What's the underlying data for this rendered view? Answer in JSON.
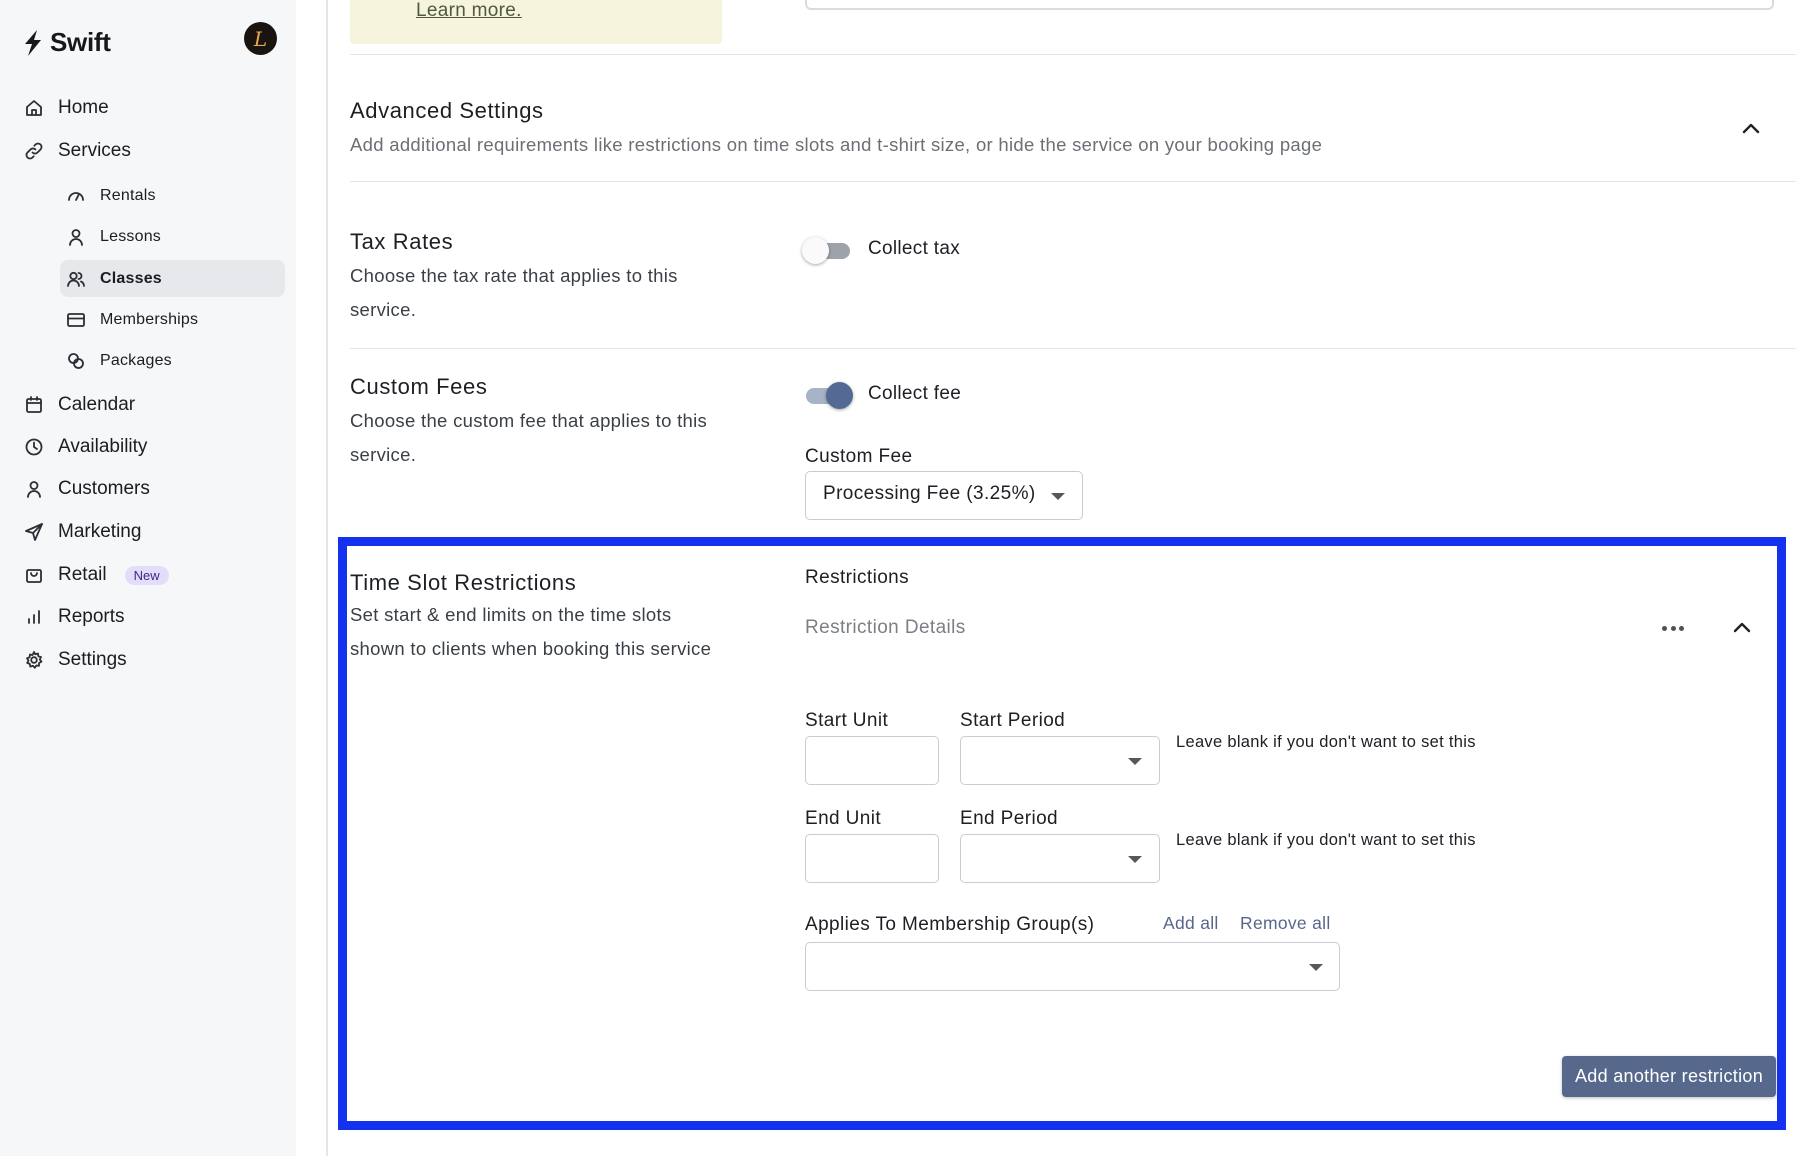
{
  "app": {
    "name": "Swift",
    "avatar_initial": "L"
  },
  "sidebar": {
    "items": [
      {
        "label": "Home",
        "icon": "home-icon"
      },
      {
        "label": "Services",
        "icon": "link-icon"
      },
      {
        "label": "Calendar",
        "icon": "calendar-icon"
      },
      {
        "label": "Availability",
        "icon": "clock-icon"
      },
      {
        "label": "Customers",
        "icon": "user-icon"
      },
      {
        "label": "Marketing",
        "icon": "send-icon"
      },
      {
        "label": "Retail",
        "icon": "bag-icon",
        "badge": "New"
      },
      {
        "label": "Reports",
        "icon": "bar-chart-icon"
      },
      {
        "label": "Settings",
        "icon": "gear-icon"
      }
    ],
    "services_sub": [
      {
        "label": "Rentals",
        "icon": "gauge-icon"
      },
      {
        "label": "Lessons",
        "icon": "person-icon"
      },
      {
        "label": "Classes",
        "icon": "people-icon",
        "active": true
      },
      {
        "label": "Memberships",
        "icon": "card-icon"
      },
      {
        "label": "Packages",
        "icon": "coins-icon"
      }
    ]
  },
  "notice": {
    "link": "Learn more."
  },
  "advanced": {
    "title": "Advanced Settings",
    "description": "Add additional requirements like restrictions on time slots and t-shirt size, or hide the service on your booking page"
  },
  "tax": {
    "title": "Tax Rates",
    "description_line1": "Choose the tax rate that applies to this",
    "description_line2": "service.",
    "toggle_label": "Collect tax",
    "enabled": false
  },
  "fees": {
    "title": "Custom Fees",
    "description_line1": "Choose the custom fee that applies to this",
    "description_line2": "service.",
    "toggle_label": "Collect fee",
    "enabled": true,
    "field_label": "Custom Fee",
    "selected": "Processing Fee (3.25%)"
  },
  "restrictions": {
    "title": "Time Slot Restrictions",
    "description_line1": "Set start & end limits on the time slots",
    "description_line2": "shown to clients when booking this service",
    "heading": "Restrictions",
    "details_label": "Restriction Details",
    "start_unit_label": "Start Unit",
    "start_unit_value": "",
    "start_period_label": "Start Period",
    "start_period_value": "",
    "start_hint": "Leave blank if you don't want to set this",
    "end_unit_label": "End Unit",
    "end_unit_value": "",
    "end_period_label": "End Period",
    "end_period_value": "",
    "end_hint": "Leave blank if you don't want to set this",
    "membership_label": "Applies To Membership Group(s)",
    "add_all": "Add all",
    "remove_all": "Remove all",
    "membership_value": "",
    "add_button": "Add another restriction"
  },
  "colors": {
    "accent": "#56698d",
    "highlight": "#1431f0",
    "badge_bg": "#e4dcfb"
  }
}
